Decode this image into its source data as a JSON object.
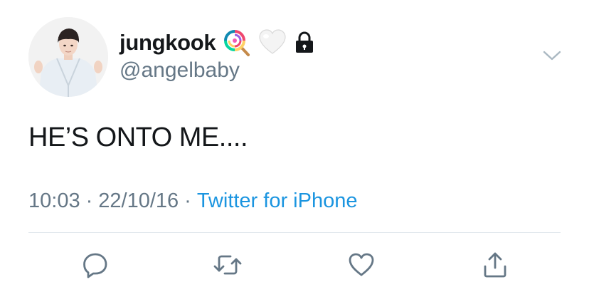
{
  "user": {
    "display_name": "jungkook",
    "handle": "@angelbaby",
    "name_emojis": [
      "lollipop-icon",
      "white-heart-icon",
      "lock-icon"
    ]
  },
  "tweet": {
    "text": "HE’S ONTO ME....",
    "time": "10:03",
    "date": "22/10/16",
    "separator": "·",
    "source": "Twitter for iPhone"
  },
  "actions": [
    "reply-icon",
    "retweet-icon",
    "like-icon",
    "share-icon"
  ],
  "colors": {
    "text_primary": "#14171a",
    "text_secondary": "#657786",
    "link": "#1b95e0",
    "divider": "#e1e8ed",
    "icon": "#657786"
  }
}
